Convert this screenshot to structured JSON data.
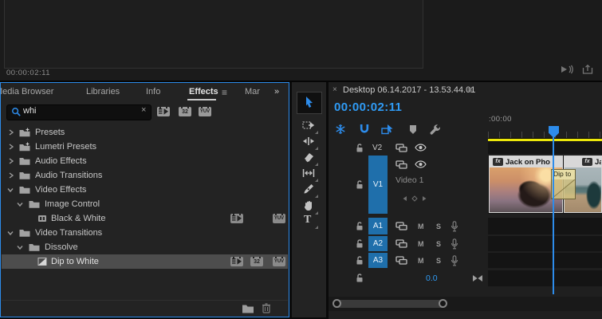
{
  "colors": {
    "accent_blue": "#2d8ceb",
    "timecode_blue": "#2f9bf5",
    "track_target_blue": "#1f6fab",
    "render_bar_yellow": "#ece70b",
    "panel_focus_border": "#2d8ceb",
    "selected_row_gray": "#4d4d4d",
    "clip_header_light": "#d8d8d8",
    "transition_khaki": "#d0c180"
  },
  "program_monitor": {
    "timecode": "00:00:02:11"
  },
  "effects_panel": {
    "tabs": {
      "media_browser": "Media Browser",
      "libraries": "Libraries",
      "info": "Info",
      "effects": "Effects",
      "markers": "Mar",
      "menu_glyph": "≡",
      "overflow_glyph": "»"
    },
    "search": {
      "value": "whi",
      "clear_glyph": "×"
    },
    "filters": {
      "bit32_badge": "32",
      "yuv_badge": "YUV"
    },
    "tree": [
      {
        "label": "Presets"
      },
      {
        "label": "Lumetri Presets"
      },
      {
        "label": "Audio Effects"
      },
      {
        "label": "Audio Transitions"
      },
      {
        "label": "Video Effects"
      },
      {
        "label": "Image Control"
      },
      {
        "label": "Black & White"
      },
      {
        "label": "Video Transitions"
      },
      {
        "label": "Dissolve"
      },
      {
        "label": "Dip to White"
      }
    ]
  },
  "tools": {
    "items": [
      "selection",
      "track-select-forward",
      "ripple-edit",
      "razor",
      "slip",
      "pen",
      "hand",
      "type"
    ],
    "type_glyph": "T"
  },
  "timeline": {
    "tab": {
      "close_glyph": "×",
      "title": "Desktop 06.14.2017 - 13.53.44.01",
      "menu_glyph": "≡"
    },
    "timecode": "00:00:02:11",
    "ruler": {
      "label": ":00:00"
    },
    "tracks": {
      "v2": "V2",
      "v1": "V1",
      "a1": "A1",
      "a2": "A2",
      "a3": "A3",
      "video1_label": "Video 1",
      "mute": "M",
      "solo": "S",
      "master_level": "0.0"
    },
    "clips": {
      "clip1_name": "Jack on Pho",
      "clip2_name": "Ja",
      "fx_badge": "fx"
    },
    "transition_label": "Dip to"
  }
}
